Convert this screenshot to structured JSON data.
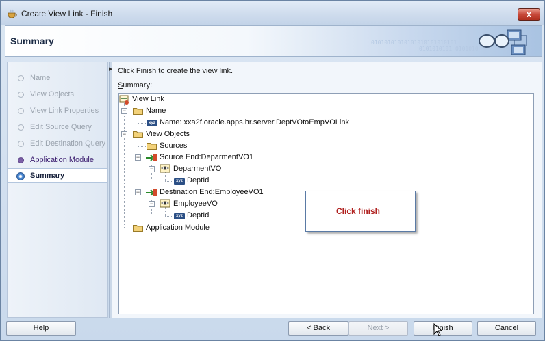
{
  "window": {
    "title": "Create View Link - Finish",
    "close_symbol": "x"
  },
  "header": {
    "title": "Summary",
    "binary_line1": "01010101010101010101010101",
    "binary_line2": "0101010101 0101010"
  },
  "nav": {
    "items": [
      {
        "label": "Name",
        "state": "disabled"
      },
      {
        "label": "View Objects",
        "state": "disabled"
      },
      {
        "label": "View Link Properties",
        "state": "disabled"
      },
      {
        "label": "Edit Source Query",
        "state": "disabled"
      },
      {
        "label": "Edit Destination Query",
        "state": "disabled"
      },
      {
        "label": "Application Module",
        "state": "link"
      },
      {
        "label": "Summary",
        "state": "current"
      }
    ]
  },
  "content": {
    "instruction": "Click Finish to create the view link.",
    "summary_label_first": "S",
    "summary_label_rest": "ummary:"
  },
  "tree": {
    "root": "View Link",
    "name_node": "Name",
    "name_value": "Name: xxa2f.oracle.apps.hr.server.DeptVOtoEmpVOLink",
    "view_objects": "View Objects",
    "sources": "Sources",
    "source_end": "Source End:DeparmentVO1",
    "source_vo": "DeparmentVO",
    "source_attr": "DeptId",
    "destination_end": "Destination End:EmployeeVO1",
    "destination_vo": "EmployeeVO",
    "destination_attr": "DeptId",
    "app_module": "Application Module"
  },
  "callout": {
    "text": "Click finish"
  },
  "buttons": {
    "help_underline": "H",
    "help_rest": "elp",
    "back_prefix": "< ",
    "back_underline": "B",
    "back_rest": "ack",
    "next_underline": "N",
    "next_rest": "ext >",
    "finish_underline": "F",
    "finish_rest": "inish",
    "cancel": "Cancel"
  },
  "icons": {
    "app": "coffee-cup-icon",
    "header_art": "glasses-network-icon",
    "attribute": "xyz-attribute-icon",
    "folder": "folder-icon",
    "viewlink": "viewlink-icon",
    "viewobject": "viewobject-icon"
  },
  "colors": {
    "callout_text": "#b0211f",
    "link": "#3a1b6e",
    "close_button": "#c7493a"
  }
}
